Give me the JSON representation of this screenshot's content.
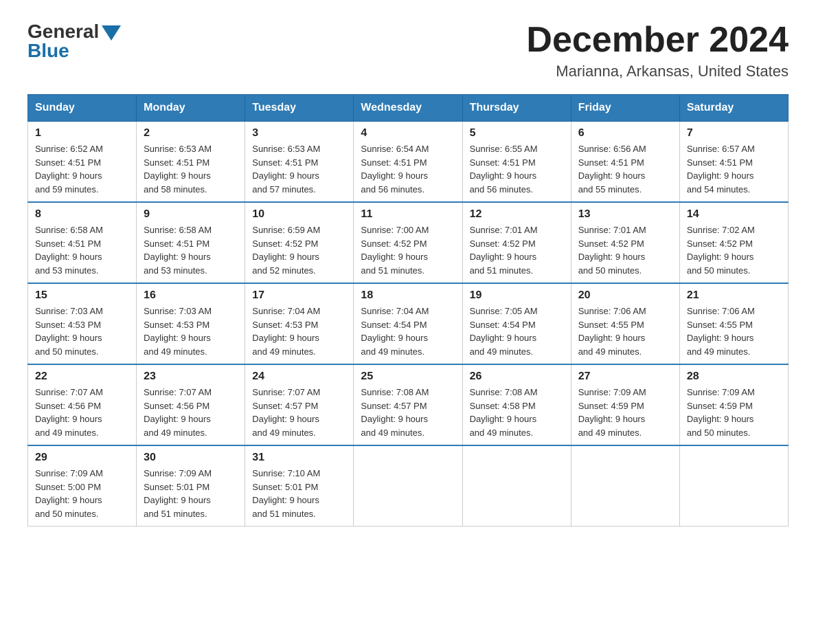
{
  "header": {
    "logo_general": "General",
    "logo_blue": "Blue",
    "month_year": "December 2024",
    "location": "Marianna, Arkansas, United States"
  },
  "weekdays": [
    "Sunday",
    "Monday",
    "Tuesday",
    "Wednesday",
    "Thursday",
    "Friday",
    "Saturday"
  ],
  "weeks": [
    [
      {
        "day": "1",
        "sunrise": "6:52 AM",
        "sunset": "4:51 PM",
        "daylight": "9 hours and 59 minutes."
      },
      {
        "day": "2",
        "sunrise": "6:53 AM",
        "sunset": "4:51 PM",
        "daylight": "9 hours and 58 minutes."
      },
      {
        "day": "3",
        "sunrise": "6:53 AM",
        "sunset": "4:51 PM",
        "daylight": "9 hours and 57 minutes."
      },
      {
        "day": "4",
        "sunrise": "6:54 AM",
        "sunset": "4:51 PM",
        "daylight": "9 hours and 56 minutes."
      },
      {
        "day": "5",
        "sunrise": "6:55 AM",
        "sunset": "4:51 PM",
        "daylight": "9 hours and 56 minutes."
      },
      {
        "day": "6",
        "sunrise": "6:56 AM",
        "sunset": "4:51 PM",
        "daylight": "9 hours and 55 minutes."
      },
      {
        "day": "7",
        "sunrise": "6:57 AM",
        "sunset": "4:51 PM",
        "daylight": "9 hours and 54 minutes."
      }
    ],
    [
      {
        "day": "8",
        "sunrise": "6:58 AM",
        "sunset": "4:51 PM",
        "daylight": "9 hours and 53 minutes."
      },
      {
        "day": "9",
        "sunrise": "6:58 AM",
        "sunset": "4:51 PM",
        "daylight": "9 hours and 53 minutes."
      },
      {
        "day": "10",
        "sunrise": "6:59 AM",
        "sunset": "4:52 PM",
        "daylight": "9 hours and 52 minutes."
      },
      {
        "day": "11",
        "sunrise": "7:00 AM",
        "sunset": "4:52 PM",
        "daylight": "9 hours and 51 minutes."
      },
      {
        "day": "12",
        "sunrise": "7:01 AM",
        "sunset": "4:52 PM",
        "daylight": "9 hours and 51 minutes."
      },
      {
        "day": "13",
        "sunrise": "7:01 AM",
        "sunset": "4:52 PM",
        "daylight": "9 hours and 50 minutes."
      },
      {
        "day": "14",
        "sunrise": "7:02 AM",
        "sunset": "4:52 PM",
        "daylight": "9 hours and 50 minutes."
      }
    ],
    [
      {
        "day": "15",
        "sunrise": "7:03 AM",
        "sunset": "4:53 PM",
        "daylight": "9 hours and 50 minutes."
      },
      {
        "day": "16",
        "sunrise": "7:03 AM",
        "sunset": "4:53 PM",
        "daylight": "9 hours and 49 minutes."
      },
      {
        "day": "17",
        "sunrise": "7:04 AM",
        "sunset": "4:53 PM",
        "daylight": "9 hours and 49 minutes."
      },
      {
        "day": "18",
        "sunrise": "7:04 AM",
        "sunset": "4:54 PM",
        "daylight": "9 hours and 49 minutes."
      },
      {
        "day": "19",
        "sunrise": "7:05 AM",
        "sunset": "4:54 PM",
        "daylight": "9 hours and 49 minutes."
      },
      {
        "day": "20",
        "sunrise": "7:06 AM",
        "sunset": "4:55 PM",
        "daylight": "9 hours and 49 minutes."
      },
      {
        "day": "21",
        "sunrise": "7:06 AM",
        "sunset": "4:55 PM",
        "daylight": "9 hours and 49 minutes."
      }
    ],
    [
      {
        "day": "22",
        "sunrise": "7:07 AM",
        "sunset": "4:56 PM",
        "daylight": "9 hours and 49 minutes."
      },
      {
        "day": "23",
        "sunrise": "7:07 AM",
        "sunset": "4:56 PM",
        "daylight": "9 hours and 49 minutes."
      },
      {
        "day": "24",
        "sunrise": "7:07 AM",
        "sunset": "4:57 PM",
        "daylight": "9 hours and 49 minutes."
      },
      {
        "day": "25",
        "sunrise": "7:08 AM",
        "sunset": "4:57 PM",
        "daylight": "9 hours and 49 minutes."
      },
      {
        "day": "26",
        "sunrise": "7:08 AM",
        "sunset": "4:58 PM",
        "daylight": "9 hours and 49 minutes."
      },
      {
        "day": "27",
        "sunrise": "7:09 AM",
        "sunset": "4:59 PM",
        "daylight": "9 hours and 49 minutes."
      },
      {
        "day": "28",
        "sunrise": "7:09 AM",
        "sunset": "4:59 PM",
        "daylight": "9 hours and 50 minutes."
      }
    ],
    [
      {
        "day": "29",
        "sunrise": "7:09 AM",
        "sunset": "5:00 PM",
        "daylight": "9 hours and 50 minutes."
      },
      {
        "day": "30",
        "sunrise": "7:09 AM",
        "sunset": "5:01 PM",
        "daylight": "9 hours and 51 minutes."
      },
      {
        "day": "31",
        "sunrise": "7:10 AM",
        "sunset": "5:01 PM",
        "daylight": "9 hours and 51 minutes."
      },
      null,
      null,
      null,
      null
    ]
  ],
  "labels": {
    "sunrise": "Sunrise:",
    "sunset": "Sunset:",
    "daylight": "Daylight:"
  }
}
